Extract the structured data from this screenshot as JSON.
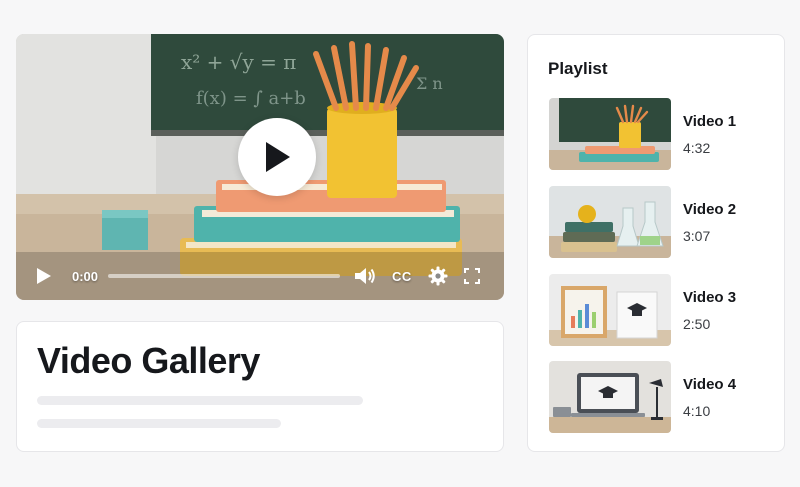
{
  "player": {
    "current_time": "0:00",
    "cc_label": "CC",
    "progress": 0.0
  },
  "info": {
    "title": "Video Gallery"
  },
  "playlist": {
    "heading": "Playlist",
    "items": [
      {
        "title": "Video 1",
        "duration": "4:32"
      },
      {
        "title": "Video 2",
        "duration": "3:07"
      },
      {
        "title": "Video 3",
        "duration": "2:50"
      },
      {
        "title": "Video 4",
        "duration": "4:10"
      }
    ]
  },
  "icons": {
    "big_play": "play-icon",
    "play": "play-icon",
    "volume": "volume-icon",
    "settings": "gear-icon",
    "fullscreen": "fullscreen-icon"
  }
}
